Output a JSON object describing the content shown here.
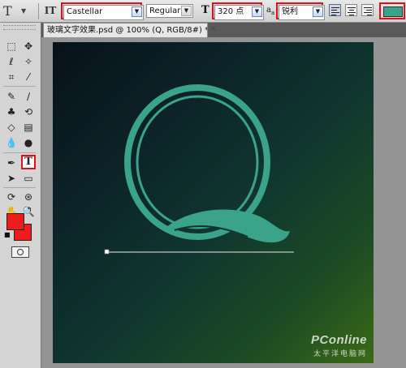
{
  "options_bar": {
    "tool_icon": "T",
    "orientation_icon": "IT",
    "font_family": "Castellar",
    "font_style": "Regular",
    "font_size": "320 点",
    "antialias": "锐利",
    "text_color": "#3aa38a",
    "highlight_color": "#e0101a"
  },
  "tools": {
    "active_tool": "T",
    "foreground_color": "#ee1c1c",
    "background_color": "#ee1c1c"
  },
  "document": {
    "tab_title": "玻璃文字效果.psd @ 100% (Q, RGB/8#) *",
    "close_icon": "×",
    "glyph": "Q",
    "glyph_color": "#3aa38a"
  },
  "watermark": {
    "logo": "PConline",
    "sub": "太平洋电脑网"
  }
}
